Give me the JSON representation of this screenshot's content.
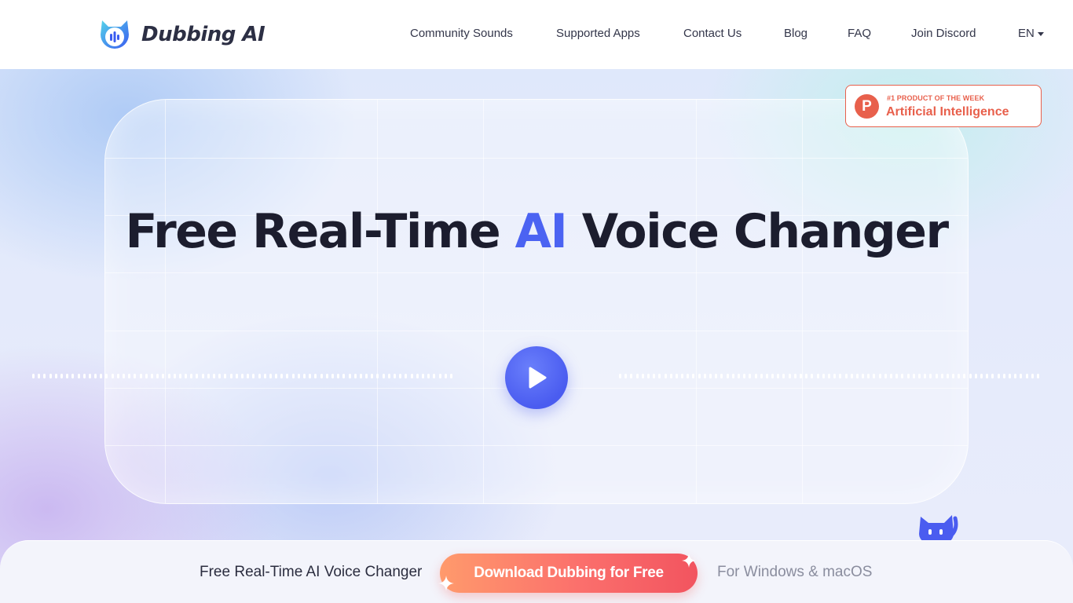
{
  "header": {
    "logo_text": "Dubbing AI",
    "nav": [
      {
        "label": "Community Sounds"
      },
      {
        "label": "Supported Apps"
      },
      {
        "label": "Contact Us"
      },
      {
        "label": "Blog"
      },
      {
        "label": "FAQ"
      },
      {
        "label": "Join Discord"
      }
    ],
    "language": "EN"
  },
  "hero": {
    "headline_part1": "Free Real-Time ",
    "headline_ai": "AI",
    "headline_part2": " Voice Changer",
    "badge": {
      "top": "#1 PRODUCT OF THE WEEK",
      "main": "Artificial Intelligence",
      "logo_letter": "P"
    }
  },
  "bottom_bar": {
    "title": "Free Real-Time AI Voice Changer",
    "cta": "Download Dubbing for Free",
    "platform": "For Windows & macOS"
  },
  "colors": {
    "accent": "#4b63f2",
    "badge": "#e8604c",
    "cta_start": "#ff9a6c",
    "cta_end": "#f2545f",
    "text_dark": "#1c1d2e"
  },
  "icons": {
    "logo": "cat-ear-logo-icon",
    "play": "play-icon",
    "mascot": "cat-mascot-icon",
    "caret": "caret-down-icon"
  }
}
